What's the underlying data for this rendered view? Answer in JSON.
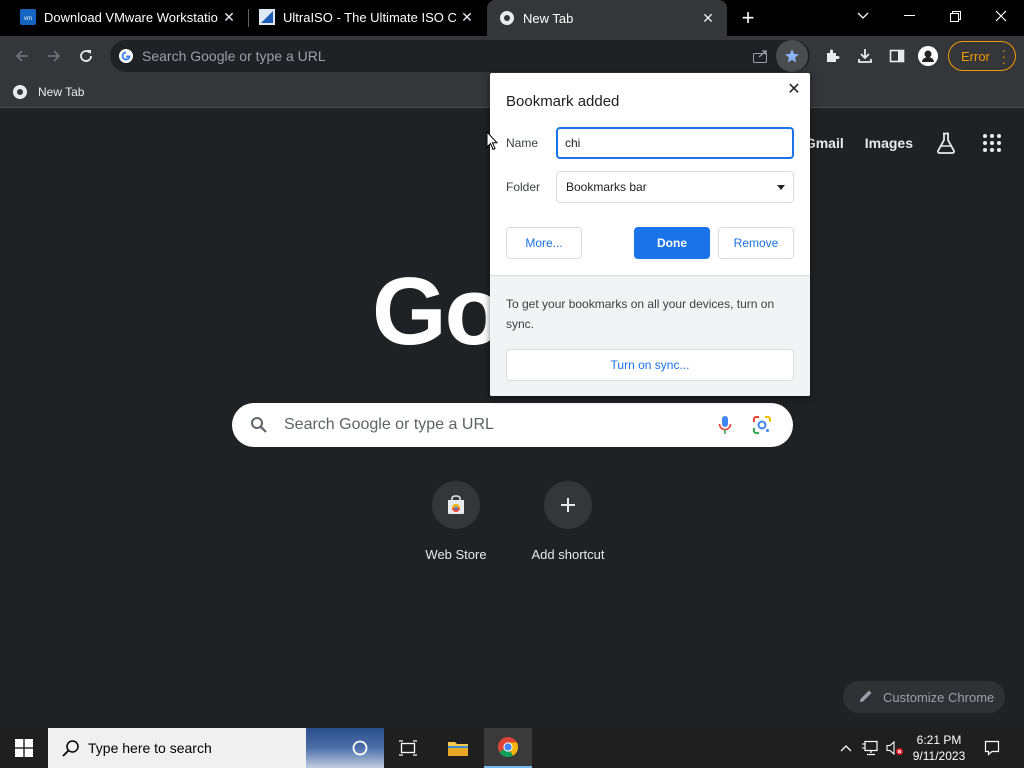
{
  "tabs": [
    {
      "title": "Download VMware Workstation P",
      "favicon": "vmware-icon",
      "active": false
    },
    {
      "title": "UltraISO - The Ultimate ISO CD/D",
      "favicon": "ultraiso-icon",
      "active": false
    },
    {
      "title": "New Tab",
      "favicon": "chrome-icon",
      "active": true
    }
  ],
  "toolbar": {
    "omnibox_placeholder": "Search Google or type a URL",
    "error_label": "Error"
  },
  "bookmarks_bar": {
    "items": [
      {
        "label": "New Tab",
        "icon": "chrome-icon"
      }
    ]
  },
  "ntp": {
    "links": {
      "gmail": "Gmail",
      "images": "Images"
    },
    "logo_text": "Go",
    "search_placeholder": "Search Google or type a URL",
    "shortcuts": [
      {
        "label": "Web Store",
        "icon": "web-store-icon"
      },
      {
        "label": "Add shortcut",
        "icon": "plus-icon"
      }
    ],
    "customize_label": "Customize Chrome"
  },
  "bubble": {
    "title": "Bookmark added",
    "name_label": "Name",
    "name_value": "chi",
    "folder_label": "Folder",
    "folder_value": "Bookmarks bar",
    "more_label": "More...",
    "done_label": "Done",
    "remove_label": "Remove",
    "sync_promo": "To get your bookmarks on all your devices, turn on sync.",
    "sync_button": "Turn on sync..."
  },
  "taskbar": {
    "search_placeholder": "Type here to search",
    "time": "6:21 PM",
    "date": "9/11/2023"
  },
  "colors": {
    "accent": "#1a73e8",
    "error": "#f29900",
    "page_bg": "#202124",
    "toolbar_bg": "#35363a"
  }
}
